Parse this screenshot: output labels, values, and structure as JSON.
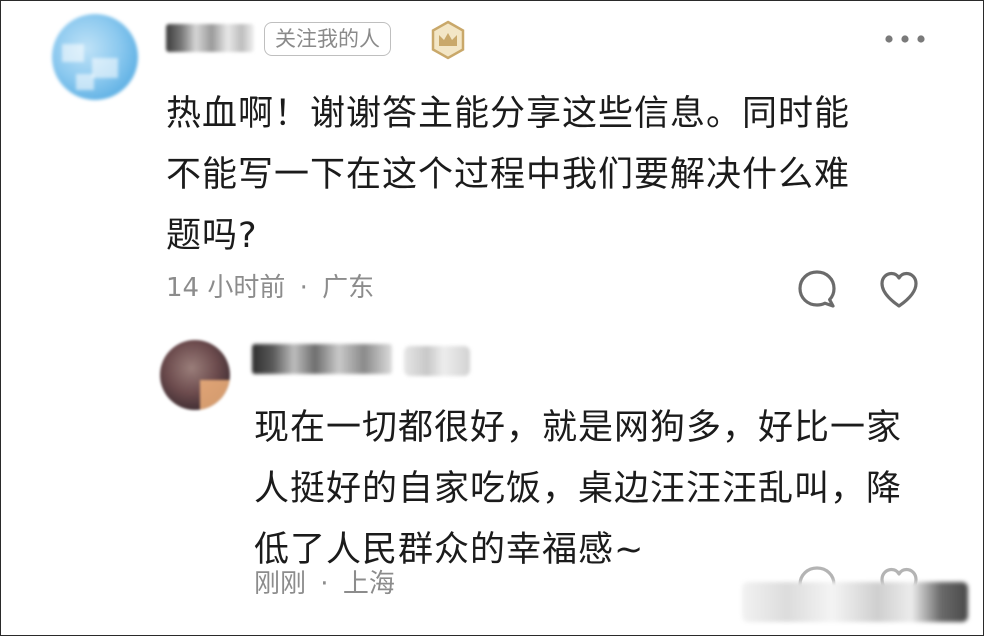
{
  "comment": {
    "follow_badge": "关注我的人",
    "text_lines": [
      "热血啊！谢谢答主能分享这些信息。同时能",
      "不能写一下在这个过程中我们要解决什么难",
      "题吗?"
    ],
    "time": "14 小时前",
    "separator": "·",
    "location": "广东",
    "icons": {
      "level": "crown-badge-icon",
      "more": "more-dots-icon",
      "reply": "comment-bubble-icon",
      "like": "heart-icon"
    }
  },
  "reply": {
    "text_lines": [
      "现在一切都很好，就是网狗多，好比一家",
      "人挺好的自家吃饭，桌边汪汪汪乱叫，降",
      "低了人民群众的幸福感~"
    ],
    "time": "刚刚",
    "separator": "·",
    "location": "上海",
    "icons": {
      "reply": "comment-bubble-icon",
      "like": "heart-icon"
    }
  },
  "colors": {
    "text": "#1b1b1b",
    "meta": "#8c8c8c",
    "badge_border": "#bfbfbf",
    "level_badge": "#c9a86a"
  }
}
